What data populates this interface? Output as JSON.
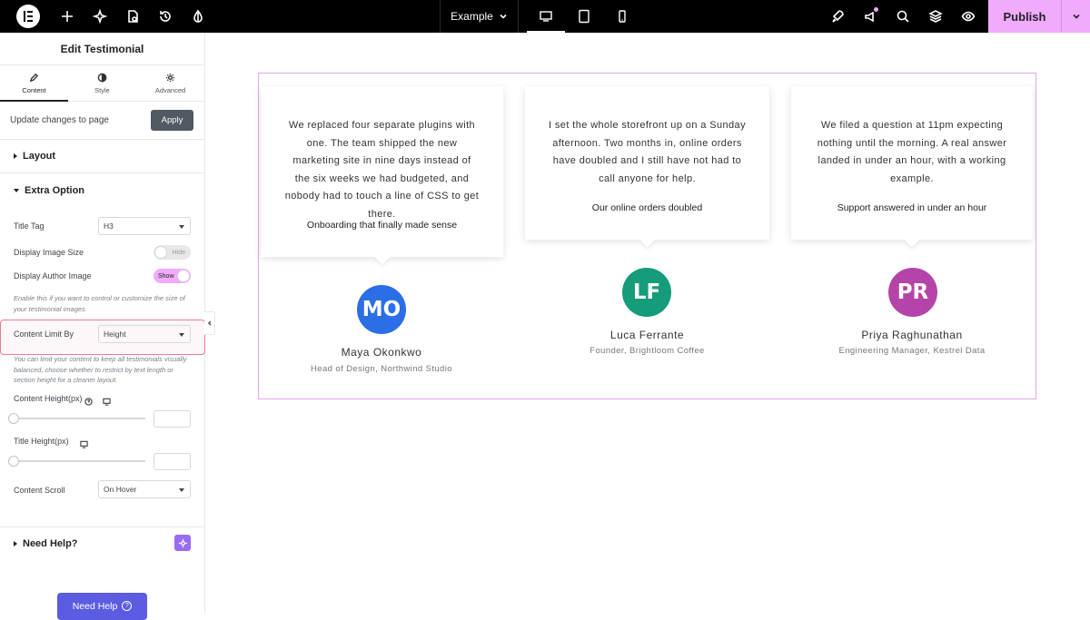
{
  "topbar": {
    "page_name": "Example",
    "publish_label": "Publish"
  },
  "panel": {
    "title": "Edit Testimonial",
    "tabs": [
      {
        "label": "Content",
        "icon": "pencil-icon"
      },
      {
        "label": "Style",
        "icon": "half-circle-icon"
      },
      {
        "label": "Advanced",
        "icon": "gear-icon"
      }
    ],
    "update_text": "Update changes to page",
    "apply_label": "Apply",
    "sections": {
      "layout": "Layout",
      "extra_option": "Extra Option",
      "need_help": "Need Help?"
    },
    "controls": {
      "title_tag_label": "Title Tag",
      "title_tag_value": "H3",
      "display_image_size_label": "Display Image Size",
      "display_image_size_state": "Hide",
      "display_author_image_label": "Display Author Image",
      "display_author_image_state": "Show",
      "author_image_help": "Enable this if you want to control or customize the size of your testimonial images.",
      "content_limit_label": "Content Limit By",
      "content_limit_value": "Height",
      "content_limit_help": "You can limit your content to keep all testimonials visually balanced, choose whether to restrict by text length or section height for a cleaner layout.",
      "content_height_label": "Content Height(px)",
      "title_height_label": "Title Height(px)",
      "content_scroll_label": "Content Scroll",
      "content_scroll_value": "On Hover"
    },
    "need_help_button": "Need Help",
    "need_help_q": "?"
  },
  "testimonials": [
    {
      "quote": "We replaced four separate plugins with one. The team shipped the new marketing site in nine days instead of the six weeks we had budgeted, and nobody had to touch a line of CSS to get there.",
      "title": "Onboarding that finally made sense",
      "initials": "MO",
      "name": "Maya Okonkwo",
      "role": "Head of Design, Northwind Studio",
      "color": "#2b6ee6"
    },
    {
      "quote": "I set the whole storefront up on a Sunday afternoon. Two months in, online orders have doubled and I still have not had to call anyone for help.",
      "title": "Our online orders doubled",
      "initials": "LF",
      "name": "Luca Ferrante",
      "role": "Founder, Brightloom Coffee",
      "color": "#169c7a"
    },
    {
      "quote": "We filed a question at 11pm expecting nothing until the morning. A real answer landed in under an hour, with a working example.",
      "title": "Support answered in under an hour",
      "initials": "PR",
      "name": "Priya Raghunathan",
      "role": "Engineering Manager, Kestrel Data",
      "color": "#b544a8"
    }
  ]
}
